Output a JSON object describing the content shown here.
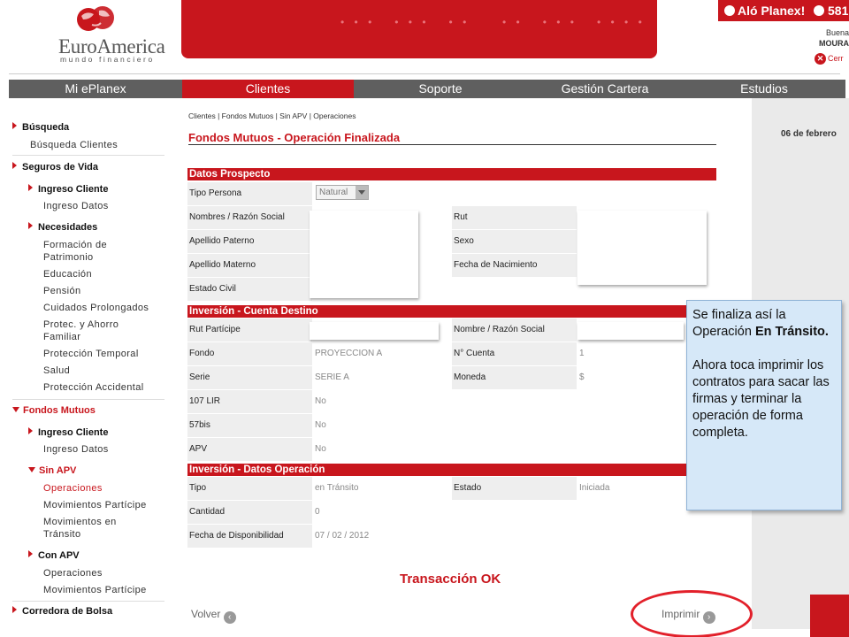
{
  "header": {
    "brand": "EuroAmerica",
    "tagline": "mundo financiero",
    "alo": "Aló Planex!",
    "phone": "581",
    "greeting": "Buena",
    "user": "MOURA",
    "logout": "Cerr"
  },
  "nav": [
    {
      "label": "Mi ePlanex"
    },
    {
      "label": "Clientes"
    },
    {
      "label": "Soporte"
    },
    {
      "label": "Gestión Cartera"
    },
    {
      "label": "Estudios"
    }
  ],
  "sidebar": {
    "busqueda": "Búsqueda",
    "busqueda_clientes": "Búsqueda Clientes",
    "seguros_vida": "Seguros de Vida",
    "ingreso_cliente_1": "Ingreso Cliente",
    "ingreso_datos_1": "Ingreso Datos",
    "necesidades": "Necesidades",
    "formacion_1": "Formación de",
    "formacion_2": "Patrimonio",
    "educacion": "Educación",
    "pension": "Pensión",
    "cuidados": "Cuidados Prolongados",
    "protec_1": "Protec. y Ahorro",
    "protec_2": "Familiar",
    "proteccion_temporal": "Protección Temporal",
    "salud": "Salud",
    "proteccion_accidental": "Protección Accidental",
    "fondos_mutuos": "Fondos Mutuos",
    "ingreso_cliente_2": "Ingreso Cliente",
    "ingreso_datos_2": "Ingreso Datos",
    "sin_apv": "Sin APV",
    "operaciones_1": "Operaciones",
    "movimientos_participe_1": "Movimientos Partícipe",
    "mov_transito_1": "Movimientos en",
    "mov_transito_2": "Tránsito",
    "con_apv": "Con APV",
    "operaciones_2": "Operaciones",
    "movimientos_participe_2": "Movimientos Partícipe",
    "corredora": "Corredora de Bolsa"
  },
  "date": "06 de febrero",
  "breadcrumb": "Clientes | Fondos Mutuos | Sin APV | Operaciones",
  "title": "Fondos Mutuos - Operación Finalizada",
  "datos_prospecto": {
    "header": "Datos Prospecto",
    "tipo_persona_label": "Tipo Persona",
    "tipo_persona_value": "Natural",
    "nombres_label": "Nombres / Razón Social",
    "rut_label": "Rut",
    "apellido_paterno_label": "Apellido Paterno",
    "sexo_label": "Sexo",
    "apellido_materno_label": "Apellido Materno",
    "fecha_nac_label": "Fecha de Nacimiento",
    "estado_civil_label": "Estado Civil"
  },
  "inversion_cuenta": {
    "header": "Inversión - Cuenta Destino",
    "rut_participe_label": "Rut Partícipe",
    "nombre_label": "Nombre / Razón Social",
    "fondo_label": "Fondo",
    "fondo_value": "PROYECCION A",
    "n_cuenta_label": "N° Cuenta",
    "n_cuenta_value": "1",
    "serie_label": "Serie",
    "serie_value": "SERIE A",
    "moneda_label": "Moneda",
    "moneda_value": "$",
    "lir_label": "107 LIR",
    "lir_value": "No",
    "bis_label": "57bis",
    "bis_value": "No",
    "apv_label": "APV",
    "apv_value": "No"
  },
  "inversion_operacion": {
    "header": "Inversión - Datos Operación",
    "tipo_label": "Tipo",
    "tipo_value": "en Tránsito",
    "estado_label": "Estado",
    "estado_value": "Iniciada",
    "cantidad_label": "Cantidad",
    "cantidad_value": "0",
    "fecha_disp_label": "Fecha de Disponibilidad",
    "fecha_disp_value": "07 / 02 / 2012"
  },
  "status": "Transacción OK",
  "volver": "Volver",
  "imprimir": "Imprimir",
  "callout": {
    "p1_a": "Se finaliza así la Operación ",
    "p1_b": "En Tránsito.",
    "p2": "Ahora toca imprimir los contratos para sacar las firmas y terminar la operación de forma completa."
  },
  "colors": {
    "brand_red": "#c8161d",
    "nav_gray": "#5f5f5f",
    "callout_bg": "#d6e8f8"
  }
}
